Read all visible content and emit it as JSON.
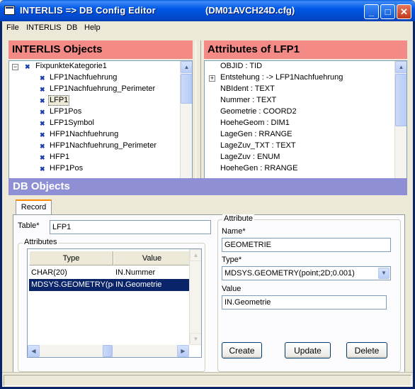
{
  "window": {
    "title": "INTERLIS => DB Config Editor",
    "file": "(DM01AVCH24D.cfg)"
  },
  "menu": [
    "File",
    "INTERLIS",
    "DB",
    "Help"
  ],
  "left_panel": {
    "header": "INTERLIS Objects",
    "root": "FixpunkteKategorie1",
    "items": [
      "LFP1Nachfuehrung",
      "LFP1Nachfuehrung_Perimeter",
      "LFP1",
      "LFP1Pos",
      "LFP1Symbol",
      "HFP1Nachfuehrung",
      "HFP1Nachfuehrung_Perimeter",
      "HFP1",
      "HFP1Pos"
    ],
    "selected": "LFP1"
  },
  "right_panel": {
    "header": "Attributes of LFP1",
    "items": [
      "OBJID : TID",
      "Entstehung : -> LFP1Nachfuehrung",
      "NBIdent : TEXT",
      "Nummer : TEXT",
      "Geometrie : COORD2",
      "HoeheGeom : DIM1",
      "LageGen : RRANGE",
      "LageZuv_TXT : TEXT",
      "LageZuv : ENUM",
      "HoeheGen : RRANGE"
    ]
  },
  "db_objects": {
    "header": "DB Objects",
    "tab": "Record",
    "table_label": "Table*",
    "table_value": "LFP1",
    "attributes_group": "Attributes",
    "columns": [
      "Type",
      "Value"
    ],
    "rows": [
      [
        "CHAR(20)",
        "IN.Nummer"
      ],
      [
        "MDSYS.GEOMETRY(pc",
        "IN.Geometrie"
      ]
    ],
    "attribute_group": "Attribute",
    "name_label": "Name*",
    "name_value": "GEOMETRIE",
    "type_label": "Type*",
    "type_value": "MDSYS.GEOMETRY(point;2D;0.001)",
    "value_label": "Value",
    "value_value": "IN.Geometrie",
    "buttons": {
      "create": "Create",
      "update": "Update",
      "delete": "Delete"
    }
  },
  "colors": {
    "panel_header": "#f48a86",
    "db_header": "#8f8fd6",
    "selection": "#0a246a"
  }
}
